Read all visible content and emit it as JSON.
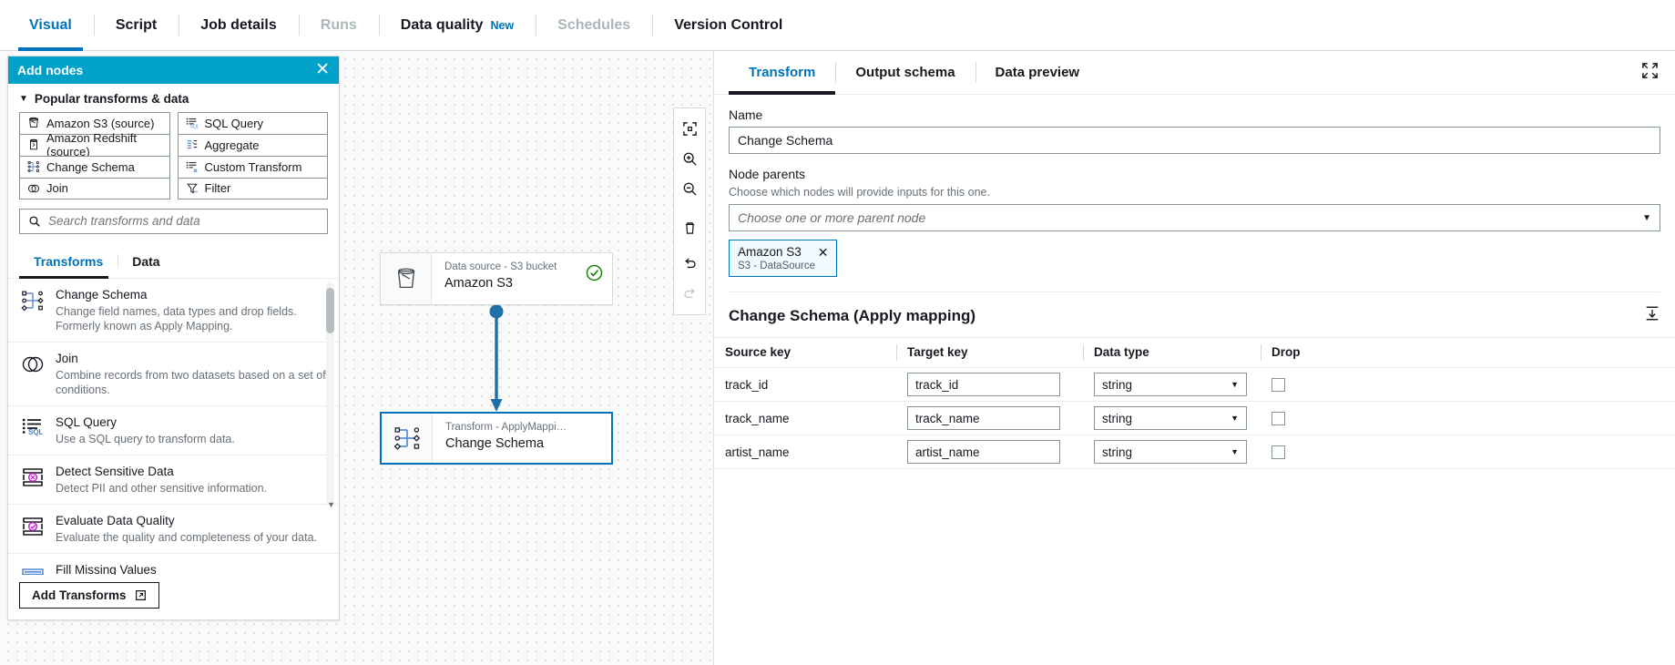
{
  "top_tabs": [
    {
      "label": "Visual",
      "state": "active"
    },
    {
      "label": "Script",
      "state": "normal"
    },
    {
      "label": "Job details",
      "state": "normal"
    },
    {
      "label": "Runs",
      "state": "disabled"
    },
    {
      "label": "Data quality",
      "state": "normal",
      "badge": "New"
    },
    {
      "label": "Schedules",
      "state": "disabled"
    },
    {
      "label": "Version Control",
      "state": "normal"
    }
  ],
  "add_nodes": {
    "title": "Add nodes",
    "close_label": "✕",
    "section_label": "Popular transforms & data",
    "caret": "▼",
    "popular_left": [
      {
        "label": "Amazon S3 (source)",
        "icon": "s3-bucket-icon"
      },
      {
        "label": "Amazon Redshift (source)",
        "icon": "redshift-icon"
      },
      {
        "label": "Change Schema",
        "icon": "change-schema-icon"
      },
      {
        "label": "Join",
        "icon": "join-icon"
      }
    ],
    "popular_right": [
      {
        "label": "SQL Query",
        "icon": "sql-query-icon"
      },
      {
        "label": "Aggregate",
        "icon": "aggregate-icon"
      },
      {
        "label": "Custom Transform",
        "icon": "custom-transform-icon"
      },
      {
        "label": "Filter",
        "icon": "filter-icon"
      }
    ],
    "search_placeholder": "Search transforms and data",
    "search_value": "",
    "tabs": [
      {
        "label": "Transforms",
        "active": true
      },
      {
        "label": "Data",
        "active": false
      }
    ],
    "transforms": [
      {
        "title": "Change Schema",
        "desc": "Change field names, data types and drop fields. Formerly known as Apply Mapping.",
        "icon": "change-schema-icon"
      },
      {
        "title": "Join",
        "desc": "Combine records from two datasets based on a set of conditions.",
        "icon": "join-icon"
      },
      {
        "title": "SQL Query",
        "desc": "Use a SQL query to transform data.",
        "icon": "sql-query-icon"
      },
      {
        "title": "Detect Sensitive Data",
        "desc": "Detect PII and other sensitive information.",
        "icon": "detect-sensitive-data-icon"
      },
      {
        "title": "Evaluate Data Quality",
        "desc": "Evaluate the quality and completeness of your data.",
        "icon": "evaluate-data-quality-icon"
      },
      {
        "title": "Fill Missing Values",
        "desc": "",
        "icon": "fill-missing-values-icon"
      }
    ],
    "add_transforms_label": "Add Transforms",
    "add_transforms_icon": "external-link-icon"
  },
  "canvas": {
    "tools": [
      {
        "name": "fit-to-screen-icon",
        "dim": false
      },
      {
        "name": "zoom-in-icon",
        "dim": false
      },
      {
        "name": "zoom-out-icon",
        "dim": false
      },
      {
        "name": "delete-icon",
        "dim": false
      },
      {
        "name": "undo-icon",
        "dim": false
      },
      {
        "name": "redo-icon",
        "dim": true
      }
    ],
    "nodes": [
      {
        "subtitle": "Data source - S3 bucket",
        "title": "Amazon S3",
        "icon": "s3-bucket-icon",
        "status": "valid",
        "selected": false
      },
      {
        "subtitle": "Transform - ApplyMappi…",
        "title": "Change Schema",
        "icon": "change-schema-icon",
        "status": "none",
        "selected": true
      }
    ]
  },
  "details": {
    "tabs": [
      {
        "label": "Transform",
        "active": true
      },
      {
        "label": "Output schema",
        "active": false
      },
      {
        "label": "Data preview",
        "active": false
      }
    ],
    "expand_icon": "expand-icon",
    "name_label": "Name",
    "name_value": "Change Schema",
    "node_parents_label": "Node parents",
    "node_parents_desc": "Choose which nodes will provide inputs for this one.",
    "node_parents_placeholder": "Choose one or more parent node",
    "parent_tokens": [
      {
        "name": "Amazon S3",
        "sub": "S3 - DataSource",
        "remove": "✕"
      }
    ],
    "mapping_title": "Change Schema (Apply mapping)",
    "mapping_action_icon": "import-schema-icon",
    "columns": [
      "Source key",
      "Target key",
      "Data type",
      "Drop"
    ],
    "rows": [
      {
        "source_key": "track_id",
        "target_key": "track_id",
        "data_type": "string",
        "drop": false
      },
      {
        "source_key": "track_name",
        "target_key": "track_name",
        "data_type": "string",
        "drop": false
      },
      {
        "source_key": "artist_name",
        "target_key": "artist_name",
        "data_type": "string",
        "drop": false
      }
    ]
  },
  "colors": {
    "accent": "#0073bb",
    "panel_header": "#00a1c9",
    "edge": "#1f6fa8",
    "success": "#1d8102"
  }
}
